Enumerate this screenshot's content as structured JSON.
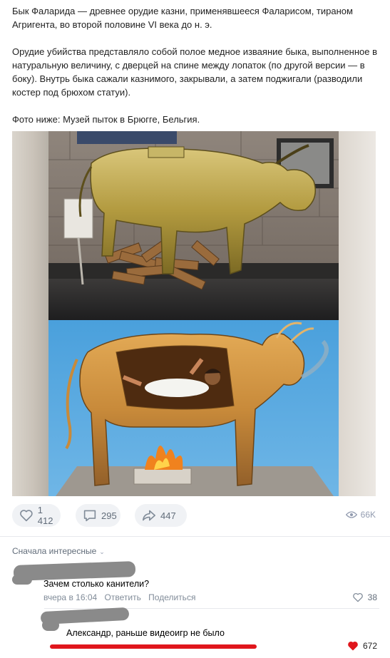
{
  "post": {
    "paragraphs": [
      "Бык Фаларида — древнее орудие казни, применявшееся Фаларисом, тираном Агригента, во второй половине VI века до н. э.",
      "Орудие убийства представляло собой полое медное изваяние быка, выполненное в натуральную величину, с дверцей на спине между лопаток (по другой версии — в боку). Внутрь быка сажали казнимого, закрывали, а затем поджигали (разводили костер под брюхом статуи).",
      "Фото ниже: Музей пыток в Брюгге, Бельгия."
    ]
  },
  "actions": {
    "likes": "1 412",
    "comments": "295",
    "shares": "447",
    "views": "66K"
  },
  "comments_section": {
    "sort_label": "Сначала интересные",
    "items": [
      {
        "text": "Зачем столько канители?",
        "time": "вчера в 16:04",
        "reply_label": "Ответить",
        "share_label": "Поделиться",
        "likes": "38",
        "liked": false
      },
      {
        "text": "Александр, раньше видеоигр не было",
        "likes": "672",
        "liked": true
      }
    ]
  },
  "colors": {
    "accent_red": "#e0161c",
    "muted_text": "#818c99",
    "pill_bg": "#f0f2f5"
  },
  "icons": [
    "heart-icon",
    "comment-icon",
    "share-icon",
    "eye-icon",
    "chevron-down-icon"
  ]
}
